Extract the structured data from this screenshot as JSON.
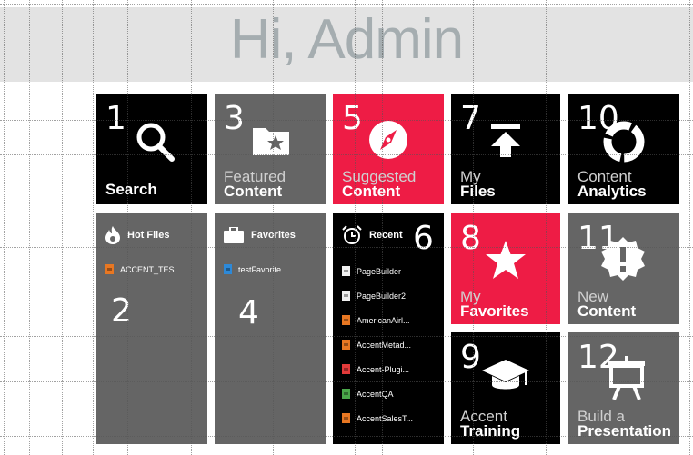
{
  "header": {
    "greeting": "Hi, Admin"
  },
  "tiles": {
    "search": {
      "number": "1",
      "label": "Search",
      "icon": "search-icon"
    },
    "hot_files": {
      "panel_number": "2",
      "title": "Hot Files",
      "icon": "flame-icon",
      "items": [
        {
          "name": "ACCENT_TES...",
          "type": "orange"
        }
      ]
    },
    "featured": {
      "number": "3",
      "line1": "Featured",
      "line2": "Content",
      "icon": "folder-star-icon"
    },
    "favorites_list": {
      "panel_number": "4",
      "title": "Favorites",
      "icon": "briefcase-icon",
      "items": [
        {
          "name": "testFavorite",
          "type": "blue"
        }
      ]
    },
    "suggested": {
      "number": "5",
      "line1": "Suggested",
      "line2": "Content",
      "icon": "compass-icon"
    },
    "recent": {
      "panel_number": "6",
      "title": "Recent",
      "icon": "alarm-clock-icon",
      "items": [
        {
          "name": "PageBuilder"
        },
        {
          "name": "PageBuilder2"
        },
        {
          "name": "AmericanAirl..."
        },
        {
          "name": "AccentMetad..."
        },
        {
          "name": "Accent-Plugi..."
        },
        {
          "name": "AccentQA"
        },
        {
          "name": "AccentSalesT..."
        }
      ]
    },
    "my_files": {
      "number": "7",
      "line1": "My",
      "line2": "Files",
      "icon": "upload-icon"
    },
    "my_favorites": {
      "number": "8",
      "line1": "My",
      "line2": "Favorites",
      "icon": "star-icon"
    },
    "training": {
      "number": "9",
      "line1": "Accent",
      "line2": "Training",
      "icon": "graduation-cap-icon"
    },
    "analytics": {
      "number": "10",
      "line1": "Content",
      "line2": "Analytics",
      "icon": "donut-chart-icon"
    },
    "new_content": {
      "number": "11",
      "line1": "New",
      "line2": "Content",
      "icon": "alert-badge-icon"
    },
    "presentation": {
      "number": "12",
      "line1": "Build a",
      "line2": "Presentation",
      "icon": "easel-icon"
    }
  },
  "colors": {
    "accent_red": "#ee1c45",
    "tile_gray": "#656565",
    "tile_black": "#000000",
    "header_bg": "#e3e3e3"
  }
}
